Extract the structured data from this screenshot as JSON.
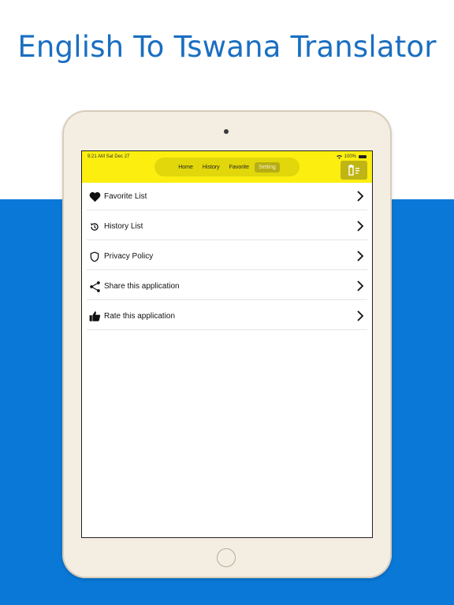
{
  "headline": "English To Tswana Translator",
  "status": {
    "time": "9:21 AM  Sat Dec 27",
    "battery": "100%"
  },
  "tabs": [
    {
      "label": "Home",
      "active": false
    },
    {
      "label": "History",
      "active": false
    },
    {
      "label": "Favorite",
      "active": false
    },
    {
      "label": "Setting",
      "active": true
    }
  ],
  "settings_items": [
    {
      "label": "Favorite List",
      "icon": "heart-icon"
    },
    {
      "label": "History List",
      "icon": "history-icon"
    },
    {
      "label": "Privacy Policy",
      "icon": "shield-icon"
    },
    {
      "label": "Share this application",
      "icon": "share-icon"
    },
    {
      "label": "Rate this application",
      "icon": "thumbs-up-icon"
    }
  ],
  "colors": {
    "brand_yellow": "#fcef10",
    "band_blue": "#0a78d7",
    "headline_blue": "#1a6fc1"
  }
}
